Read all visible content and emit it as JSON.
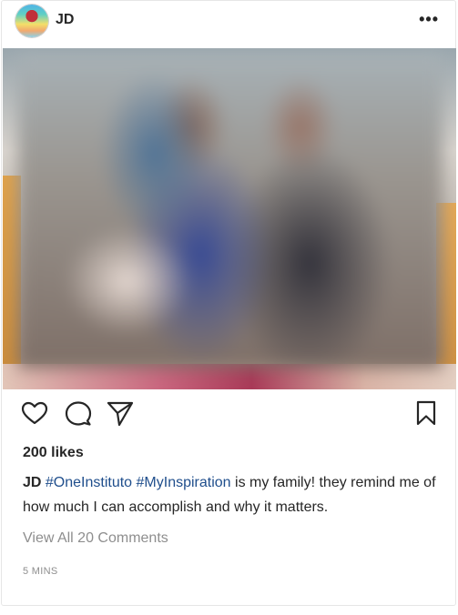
{
  "post": {
    "username": "JD",
    "more_label": "•••",
    "likes": "200 likes",
    "caption": {
      "author": "JD",
      "tag1": "#OneInstituto",
      "tag2": "#MyInspiration",
      "text": " is my family! they remind me of how much I can accomplish and why it matters."
    },
    "view_comments": "View All 20 Comments",
    "timestamp": "5 MINS"
  },
  "icons": {
    "like": "heart-icon",
    "comment": "comment-icon",
    "share": "share-icon",
    "save": "bookmark-icon",
    "more": "more-icon"
  }
}
